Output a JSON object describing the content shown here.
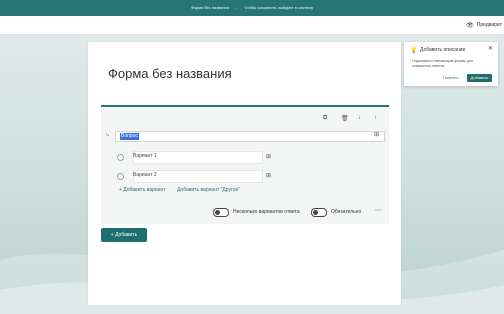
{
  "topbar": {
    "title": "Форма без названия",
    "separator": "-",
    "hint": "Чтобы сохранить, войдите в систему"
  },
  "toolbar": {
    "preview_label": "Предварит",
    "preview_icon": "eye-icon"
  },
  "form": {
    "title": "Форма без названия"
  },
  "question": {
    "text": "Вопрос",
    "tools": [
      "copy-icon",
      "trash-icon",
      "arrow-down-icon",
      "arrow-up-icon"
    ],
    "options": [
      {
        "label": "Вариант 1"
      },
      {
        "label": "Вариант 2"
      }
    ],
    "add_option": "+ Добавить вариант",
    "add_other": "Добавить вариант \"Другое\"",
    "multiple_answers": "Несколько вариантов ответа",
    "required": "Обязательно",
    "more": "⋯"
  },
  "add_button": "+ Добавить",
  "popup": {
    "title": "Добавить описание",
    "text": "Подскажите отвечающим формы для повышения ответов.",
    "later": "Понятно",
    "add": "Добавить"
  },
  "colors": {
    "brand": "#277676",
    "accent_button": "#1f6d6d",
    "selection": "#3f6fdc"
  }
}
